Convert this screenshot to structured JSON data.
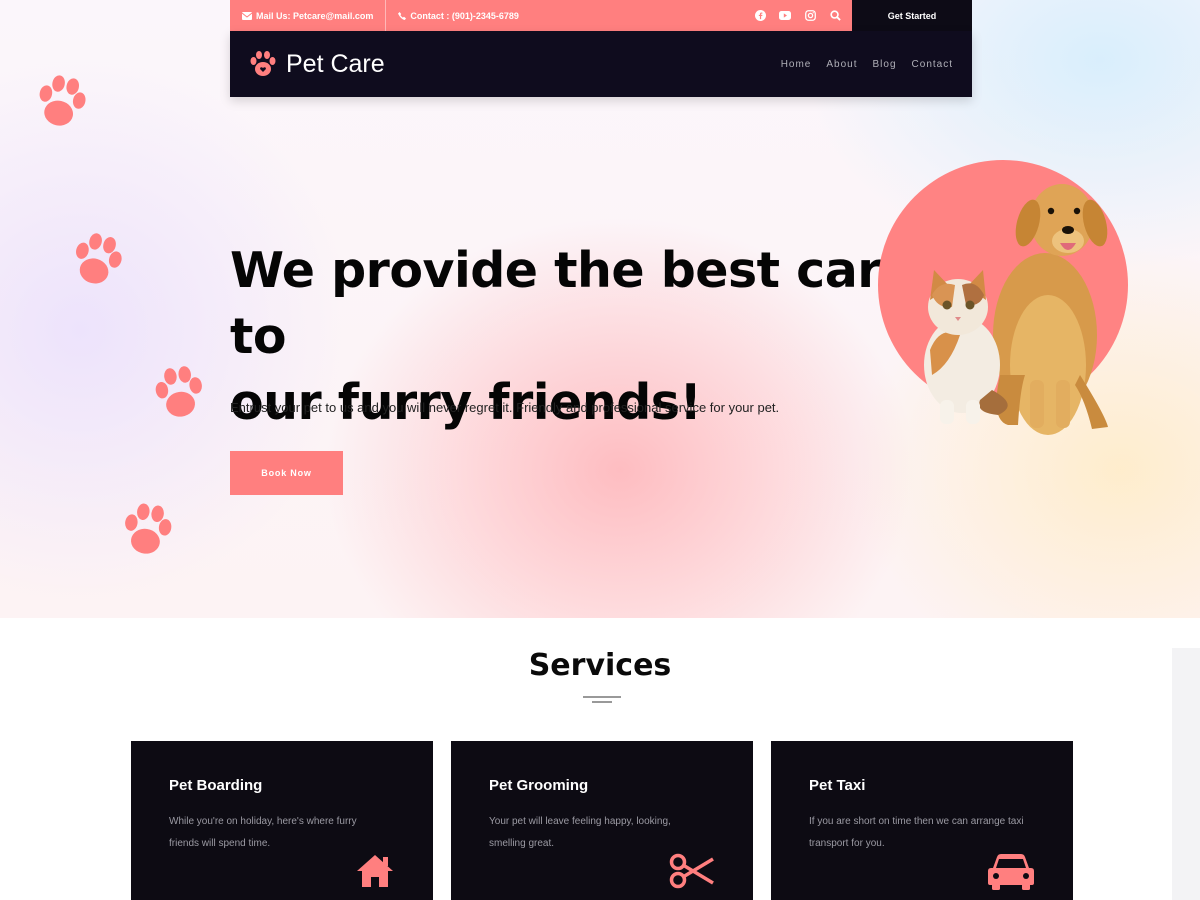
{
  "topbar": {
    "mail": "Mail Us: Petcare@mail.com",
    "contact": "Contact : (901)-2345-6789",
    "cta_label": "Get Started",
    "social_icons": [
      "facebook-icon",
      "youtube-icon",
      "instagram-icon",
      "search-icon"
    ]
  },
  "nav": {
    "logo_text": "Pet Care",
    "items": [
      {
        "label": "Home"
      },
      {
        "label": "About"
      },
      {
        "label": "Blog"
      },
      {
        "label": "Contact"
      }
    ]
  },
  "hero": {
    "headline_line1": "We provide the best care to",
    "headline_line2": "our furry friends!",
    "subtext": "Entrust your pet to us and you will never regret it. Friendly and professional service for your pet.",
    "button_label": "Book Now"
  },
  "services": {
    "title": "Services",
    "cards": [
      {
        "title": "Pet Boarding",
        "desc": "While you're on holiday, here's where furry friends will spend time.",
        "icon": "house-icon"
      },
      {
        "title": "Pet Grooming",
        "desc": "Your pet will leave feeling happy, looking, smelling great.",
        "icon": "scissors-icon"
      },
      {
        "title": "Pet Taxi",
        "desc": "If you are short on time then we can arrange taxi transport for you.",
        "icon": "car-icon"
      }
    ]
  },
  "colors": {
    "accent": "#ff7f7f",
    "dark": "#0f0c1e",
    "card_bg": "#0d0b13"
  }
}
